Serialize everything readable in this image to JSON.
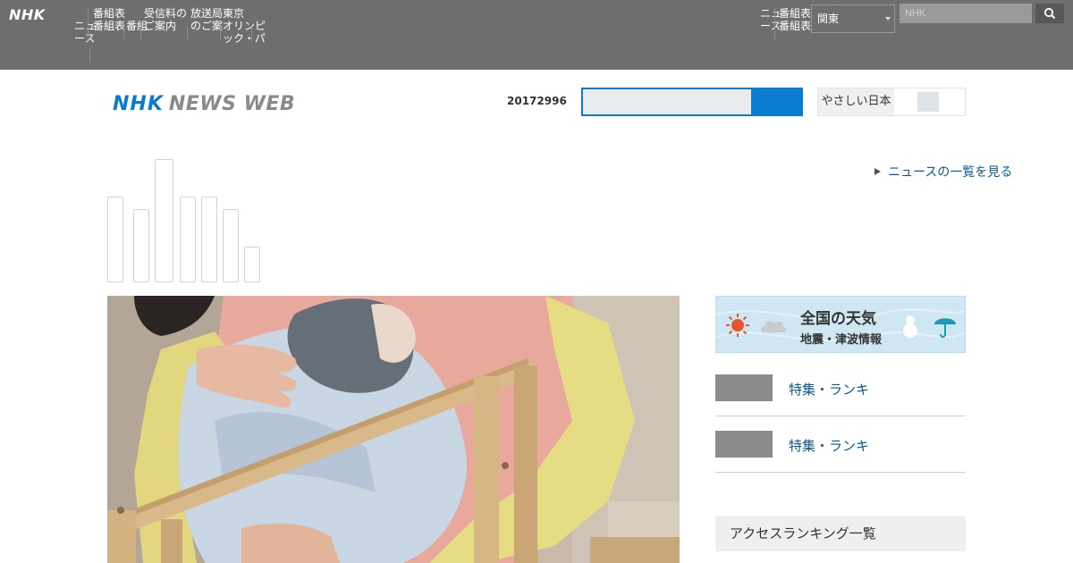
{
  "global_nav": {
    "logo": "NHK",
    "items": [
      "ニュ\nース",
      "番組表\n番組表",
      "番組",
      "受信料の\nご案内",
      "放送局\nのご案",
      "東京\nオリンピ\nック・パ"
    ],
    "right_items": [
      "ニュ\nース",
      "番組表\n番組表"
    ],
    "region": "関東",
    "search_placeholder": "NHK"
  },
  "header": {
    "logo_nhk": "NHK",
    "logo_newsweb": "NEWS WEB",
    "date": "20172996"
  },
  "toggle": {
    "label": "やさしい日本"
  },
  "more_link": {
    "label": "ニュースの一覧を見る"
  },
  "weather_banner": {
    "line1": "全国の天気",
    "line2": "地震・津波情報"
  },
  "side_links": [
    {
      "label": "特集・ランキ"
    },
    {
      "label": "特集・ランキ"
    }
  ],
  "ranking": {
    "label": "アクセスランキング一覧"
  },
  "colors": {
    "global_bar": "#6e6e6e",
    "nhk_blue": "#0a7bd1",
    "link_blue": "#0b5a8c"
  }
}
